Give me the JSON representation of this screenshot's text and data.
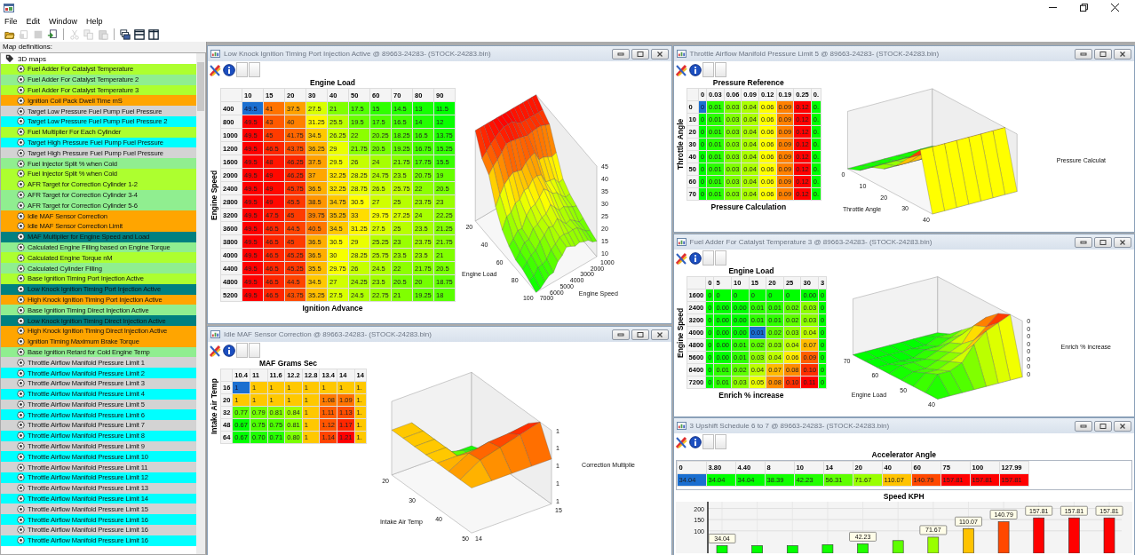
{
  "menu": [
    "File",
    "Edit",
    "Window",
    "Help"
  ],
  "toolbar": [
    [
      {
        "kind": "open",
        "disabled": false
      },
      {
        "kind": "properties",
        "disabled": true
      },
      {
        "kind": "save",
        "disabled": true
      },
      {
        "kind": "import",
        "disabled": false
      }
    ],
    [
      {
        "kind": "cut",
        "disabled": true
      },
      {
        "kind": "copy",
        "disabled": true
      },
      {
        "kind": "paste",
        "disabled": true
      }
    ],
    [
      {
        "kind": "cascade",
        "disabled": false
      },
      {
        "kind": "tile_horizontal",
        "disabled": false
      },
      {
        "kind": "tile_vertical",
        "disabled": false
      }
    ]
  ],
  "sidebar": {
    "label": "Map definitions:",
    "root": {
      "label": "3D maps",
      "children": [
        {
          "label": "Fuel Adder For Catalyst Temperature",
          "color": "#adff2f"
        },
        {
          "label": "Fuel Adder For Catalyst Temperature 2",
          "color": "#90ee90"
        },
        {
          "label": "Fuel Adder For Catalyst Temperature 3",
          "color": "#adff2f"
        },
        {
          "label": "Ignition Coil Pack Dwell Time mS",
          "color": "#ffa500"
        },
        {
          "label": "Target Low Pressure Fuel Pump Fuel Pressure",
          "color": "#d3d3d3"
        },
        {
          "label": "Target Low Pressure Fuel Pump Fuel Pressure 2",
          "color": "#00ffff"
        },
        {
          "label": "Fuel Multiplier For Each Cylinder",
          "color": "#adff2f"
        },
        {
          "label": "Target High Pressure Fuel Pump Fuel Pressure",
          "color": "#00ffff"
        },
        {
          "label": "Target High Pressure Fuel Pump Fuel Pressure",
          "color": "#d3d3d3"
        },
        {
          "label": "Fuel Injector Split % when Cold",
          "color": "#90ee90"
        },
        {
          "label": "Fuel Injector Split % when Cold",
          "color": "#adff2f"
        },
        {
          "label": "AFR Target for Correction Cylinder 1-2",
          "color": "#adff2f"
        },
        {
          "label": "AFR Target for Correction Cylinder 3-4",
          "color": "#90ee90"
        },
        {
          "label": "AFR Target for Correction Cylinder 5-6",
          "color": "#90ee90"
        },
        {
          "label": "Idle MAF Sensor Correction",
          "color": "#ffa500"
        },
        {
          "label": "Idle MAF Sensor Correction Limit",
          "color": "#ffa500"
        },
        {
          "label": "MAF Multiplier for Engine Speed and Load",
          "color": "#008080"
        },
        {
          "label": "Calculated Engine Filling based on Engine Torque",
          "color": "#90ee90"
        },
        {
          "label": "Calculated Engine Torque nM",
          "color": "#adff2f"
        },
        {
          "label": "Calculated Cylinder Filling",
          "color": "#90ee90"
        },
        {
          "label": "Base Ignition Timing Port Injection Active",
          "color": "#adff2f"
        },
        {
          "label": "Low Knock Ignition Timing Port Injection Active",
          "color": "#008080"
        },
        {
          "label": "High Knock Ignition Timing Port Injection Active",
          "color": "#ffa500"
        },
        {
          "label": "Base Ignition Timing Direct Injection Active",
          "color": "#90ee90"
        },
        {
          "label": "Low Knock Ignition Timing Direct Injection Active",
          "color": "#008080"
        },
        {
          "label": "High Knock Ignition Timing Direct Injection Active",
          "color": "#ffa500"
        },
        {
          "label": "Ignition Timing Maximum Brake Torque",
          "color": "#ffa500"
        },
        {
          "label": "Base Ignition Retard for Cold Engine Temp",
          "color": "#90ee90"
        },
        {
          "label": "Throttle Airflow Manifold Pressure Limit 1",
          "color": "#d3d3d3"
        },
        {
          "label": "Throttle Airflow Manifold Pressure Limit 2",
          "color": "#00ffff"
        },
        {
          "label": "Throttle Airflow Manifold Pressure Limit 3",
          "color": "#d3d3d3"
        },
        {
          "label": "Throttle Airflow Manifold Pressure Limit 4",
          "color": "#00ffff"
        },
        {
          "label": "Throttle Airflow Manifold Pressure Limit 5",
          "color": "#d3d3d3"
        },
        {
          "label": "Throttle Airflow Manifold Pressure Limit 6",
          "color": "#00ffff"
        },
        {
          "label": "Throttle Airflow Manifold Pressure Limit 7",
          "color": "#d3d3d3"
        },
        {
          "label": "Throttle Airflow Manifold Pressure Limit 8",
          "color": "#00ffff"
        },
        {
          "label": "Throttle Airflow Manifold Pressure Limit 9",
          "color": "#d3d3d3"
        },
        {
          "label": "Throttle Airflow Manifold Pressure Limit 10",
          "color": "#00ffff"
        },
        {
          "label": "Throttle Airflow Manifold Pressure Limit 11",
          "color": "#d3d3d3"
        },
        {
          "label": "Throttle Airflow Manifold Pressure Limit 12",
          "color": "#00ffff"
        },
        {
          "label": "Throttle Airflow Manifold Pressure Limit 13",
          "color": "#d3d3d3"
        },
        {
          "label": "Throttle Airflow Manifold Pressure Limit 14",
          "color": "#00ffff"
        },
        {
          "label": "Throttle Airflow Manifold Pressure Limit 15",
          "color": "#d3d3d3"
        },
        {
          "label": "Throttle Airflow Manifold Pressure Limit 16",
          "color": "#00ffff"
        },
        {
          "label": "Throttle Airflow Manifold Pressure Limit 16",
          "color": "#d3d3d3"
        },
        {
          "label": "Throttle Airflow Manifold Pressure Limit 16",
          "color": "#00ffff"
        }
      ]
    }
  },
  "windows": [
    {
      "kind": "map",
      "title": "Low Knock Ignition Timing Port Injection Active @ 89663-24283- (STOCK-24283.bin)",
      "table": {
        "column_axis": "Engine Load",
        "row_axis": "Engine Speed",
        "value_axis": "Ignition Advance",
        "columns": [
          "10",
          "15",
          "20",
          "30",
          "40",
          "50",
          "60",
          "70",
          "80",
          "90"
        ],
        "rows": [
          {
            "label": "400",
            "cells": [
              "49.5",
              "41",
              "37.5",
              "27.5",
              "21",
              "17.5",
              "15",
              "14.5",
              "13",
              "11.5"
            ],
            "selected": [
              true,
              false,
              false,
              false,
              false,
              false,
              false,
              false,
              false,
              false
            ]
          },
          {
            "label": "800",
            "cells": [
              "49.5",
              "43",
              "40",
              "31.25",
              "25.5",
              "19.5",
              "17.5",
              "16.5",
              "14",
              "12"
            ],
            "selected": [
              false,
              false,
              false,
              false,
              false,
              false,
              false,
              false,
              false,
              false
            ]
          },
          {
            "label": "1000",
            "cells": [
              "49.5",
              "45",
              "41.75",
              "34.5",
              "26.25",
              "22",
              "20.25",
              "18.25",
              "16.5",
              "13.75"
            ],
            "selected": [
              false,
              false,
              false,
              false,
              false,
              false,
              false,
              false,
              false,
              false
            ]
          },
          {
            "label": "1200",
            "cells": [
              "49.5",
              "46.5",
              "43.75",
              "36.25",
              "29",
              "21.75",
              "20.5",
              "19.25",
              "16.75",
              "15.25"
            ],
            "selected": [
              false,
              false,
              false,
              false,
              false,
              false,
              false,
              false,
              false,
              false
            ]
          },
          {
            "label": "1600",
            "cells": [
              "49.5",
              "48",
              "46.25",
              "37.5",
              "29.5",
              "26",
              "24",
              "21.75",
              "17.75",
              "15.5"
            ],
            "selected": [
              false,
              false,
              false,
              false,
              false,
              false,
              false,
              false,
              false,
              false
            ]
          },
          {
            "label": "2000",
            "cells": [
              "49.5",
              "49",
              "46.25",
              "37",
              "32.25",
              "28.25",
              "24.75",
              "23.5",
              "20.75",
              "19"
            ],
            "selected": [
              false,
              false,
              false,
              false,
              false,
              false,
              false,
              false,
              false,
              false
            ]
          },
          {
            "label": "2400",
            "cells": [
              "49.5",
              "49",
              "45.75",
              "36.5",
              "32.25",
              "28.75",
              "26.5",
              "25.75",
              "22",
              "20.5"
            ],
            "selected": [
              false,
              false,
              false,
              false,
              false,
              false,
              false,
              false,
              false,
              false
            ]
          },
          {
            "label": "2800",
            "cells": [
              "49.5",
              "49",
              "45.5",
              "38.5",
              "34.75",
              "30.5",
              "27",
              "25",
              "23.75",
              "23"
            ],
            "selected": [
              false,
              false,
              false,
              false,
              false,
              false,
              false,
              false,
              false,
              false
            ]
          },
          {
            "label": "3200",
            "cells": [
              "49.5",
              "47.5",
              "45",
              "39.75",
              "35.25",
              "33",
              "29.75",
              "27.25",
              "24",
              "22.25"
            ],
            "selected": [
              false,
              false,
              false,
              false,
              false,
              false,
              false,
              false,
              false,
              false
            ]
          },
          {
            "label": "3600",
            "cells": [
              "49.5",
              "46.5",
              "44.5",
              "40.5",
              "34.5",
              "31.25",
              "27.5",
              "25",
              "23.5",
              "21.25"
            ],
            "selected": [
              false,
              false,
              false,
              false,
              false,
              false,
              false,
              false,
              false,
              false
            ]
          },
          {
            "label": "3800",
            "cells": [
              "49.5",
              "46.5",
              "45",
              "36.5",
              "30.5",
              "29",
              "25.25",
              "23",
              "23.75",
              "21.75"
            ],
            "selected": [
              false,
              false,
              false,
              false,
              false,
              false,
              false,
              false,
              false,
              false
            ]
          },
          {
            "label": "4000",
            "cells": [
              "49.5",
              "46.5",
              "45.25",
              "36.5",
              "30",
              "28.25",
              "25.75",
              "23.5",
              "23.5",
              "21"
            ],
            "selected": [
              false,
              false,
              false,
              false,
              false,
              false,
              false,
              false,
              false,
              false
            ]
          },
          {
            "label": "4400",
            "cells": [
              "49.5",
              "46.5",
              "45.25",
              "35.5",
              "29.75",
              "26",
              "24.5",
              "22",
              "21.75",
              "20.5"
            ],
            "selected": [
              false,
              false,
              false,
              false,
              false,
              false,
              false,
              false,
              false,
              false
            ]
          },
          {
            "label": "4800",
            "cells": [
              "49.5",
              "46.5",
              "44.5",
              "34.5",
              "27",
              "24.25",
              "23.5",
              "20.5",
              "20",
              "18.75"
            ],
            "selected": [
              false,
              false,
              false,
              false,
              false,
              false,
              false,
              false,
              false,
              false
            ]
          },
          {
            "label": "5200",
            "cells": [
              "49.5",
              "46.5",
              "43.75",
              "35.25",
              "27.5",
              "24.5",
              "22.75",
              "21",
              "19.25",
              "18"
            ],
            "selected": [
              false,
              false,
              false,
              false,
              false,
              false,
              false,
              false,
              false,
              false
            ]
          }
        ]
      },
      "plot": {
        "x_title": "Engine Load",
        "x_ticks": [
          "20",
          "40",
          "60",
          "80",
          "100"
        ],
        "y_title": "Engine Speed",
        "y_ticks": [
          "7000",
          "6000",
          "5000",
          "4000",
          "3000",
          "2000",
          "1000"
        ],
        "z_ticks": [
          "45",
          "40",
          "35",
          "30",
          "25",
          "20",
          "15",
          "10"
        ]
      }
    },
    {
      "kind": "map",
      "title": "Throttle Airflow Manifold Pressure Limit 5 @ 89663-24283- (STOCK-24283.bin)",
      "table": {
        "column_axis": "Pressure Reference",
        "row_axis": "Throttle Angle",
        "value_axis": "Pressure Calculation",
        "columns": [
          "0",
          "0.03",
          "0.06",
          "0.09",
          "0.12",
          "0.19",
          "0.25",
          "0."
        ],
        "rows": [
          {
            "label": "0",
            "cells": [
              "0",
              "0.01",
              "0.03",
              "0.04",
              "0.06",
              "0.09",
              "0.12",
              "0."
            ],
            "selected": [
              true,
              false,
              false,
              false,
              false,
              false,
              false,
              false
            ]
          },
          {
            "label": "10",
            "cells": [
              "0",
              "0.01",
              "0.03",
              "0.04",
              "0.06",
              "0.09",
              "0.12",
              "0."
            ],
            "selected": [
              false,
              false,
              false,
              false,
              false,
              false,
              false,
              false
            ]
          },
          {
            "label": "20",
            "cells": [
              "0",
              "0.01",
              "0.03",
              "0.04",
              "0.06",
              "0.09",
              "0.12",
              "0."
            ],
            "selected": [
              false,
              false,
              false,
              false,
              false,
              false,
              false,
              false
            ]
          },
          {
            "label": "30",
            "cells": [
              "0",
              "0.01",
              "0.03",
              "0.04",
              "0.06",
              "0.09",
              "0.12",
              "0."
            ],
            "selected": [
              false,
              false,
              false,
              false,
              false,
              false,
              false,
              false
            ]
          },
          {
            "label": "40",
            "cells": [
              "0",
              "0.01",
              "0.03",
              "0.04",
              "0.06",
              "0.09",
              "0.12",
              "0."
            ],
            "selected": [
              false,
              false,
              false,
              false,
              false,
              false,
              false,
              false
            ]
          },
          {
            "label": "50",
            "cells": [
              "0",
              "0.01",
              "0.03",
              "0.04",
              "0.06",
              "0.09",
              "0.12",
              "0."
            ],
            "selected": [
              false,
              false,
              false,
              false,
              false,
              false,
              false,
              false
            ]
          },
          {
            "label": "60",
            "cells": [
              "0",
              "0.01",
              "0.03",
              "0.04",
              "0.06",
              "0.09",
              "0.12",
              "0."
            ],
            "selected": [
              false,
              false,
              false,
              false,
              false,
              false,
              false,
              false
            ]
          },
          {
            "label": "70",
            "cells": [
              "0",
              "0.01",
              "0.03",
              "0.04",
              "0.06",
              "0.09",
              "0.12",
              "0."
            ],
            "selected": [
              false,
              false,
              false,
              false,
              false,
              false,
              false,
              false
            ]
          }
        ]
      },
      "plot": {
        "x_title": "Throttle Angle",
        "x_ticks": [
          "0",
          "10",
          "20",
          "30",
          "40"
        ],
        "z_title": "Pressure Calculat"
      }
    },
    {
      "kind": "map",
      "title": "Fuel Adder For Catalyst Temperature 3 @ 89663-24283- (STOCK-24283.bin)",
      "table": {
        "column_axis": "Engine Load",
        "row_axis": "Engine Speed",
        "value_axis": "Enrich % increase",
        "columns": [
          "0",
          "5",
          "10",
          "15",
          "20",
          "25",
          "30",
          "3"
        ],
        "rows": [
          {
            "label": "1600",
            "cells": [
              "0",
              "0",
              "0",
              "0",
              "0",
              "0",
              "0.00",
              "0"
            ],
            "selected": [
              false,
              false,
              false,
              false,
              false,
              false,
              false,
              false
            ]
          },
          {
            "label": "2400",
            "cells": [
              "0",
              "0.00",
              "0.00",
              "0.01",
              "0.01",
              "0.02",
              "0.03",
              "0"
            ],
            "selected": [
              false,
              false,
              false,
              false,
              false,
              false,
              false,
              false
            ]
          },
          {
            "label": "3200",
            "cells": [
              "0",
              "0.00",
              "0.00",
              "0.01",
              "0.01",
              "0.02",
              "0.03",
              "0"
            ],
            "selected": [
              false,
              false,
              false,
              false,
              false,
              false,
              false,
              false
            ]
          },
          {
            "label": "4000",
            "cells": [
              "0",
              "0.00",
              "0.00",
              "0.01",
              "0.02",
              "0.03",
              "0.04",
              "0"
            ],
            "selected": [
              false,
              false,
              false,
              true,
              false,
              false,
              false,
              false
            ]
          },
          {
            "label": "4800",
            "cells": [
              "0",
              "0.00",
              "0.01",
              "0.02",
              "0.03",
              "0.04",
              "0.07",
              "0"
            ],
            "selected": [
              false,
              false,
              false,
              false,
              false,
              false,
              false,
              false
            ]
          },
          {
            "label": "5600",
            "cells": [
              "0",
              "0.00",
              "0.01",
              "0.03",
              "0.04",
              "0.06",
              "0.09",
              "0"
            ],
            "selected": [
              false,
              false,
              false,
              false,
              false,
              false,
              false,
              false
            ]
          },
          {
            "label": "6400",
            "cells": [
              "0",
              "0.01",
              "0.02",
              "0.04",
              "0.07",
              "0.08",
              "0.10",
              "0"
            ],
            "selected": [
              false,
              false,
              false,
              false,
              false,
              false,
              false,
              false
            ]
          },
          {
            "label": "7200",
            "cells": [
              "0",
              "0.01",
              "0.03",
              "0.05",
              "0.08",
              "0.10",
              "0.11",
              "0"
            ],
            "selected": [
              false,
              false,
              false,
              false,
              false,
              false,
              false,
              false
            ]
          }
        ]
      },
      "plot": {
        "x_title": "Engine Load",
        "x_ticks": [
          "70",
          "60",
          "50",
          "40"
        ],
        "z_title": "Enrich % increase",
        "z_ticks": [
          "0",
          "0",
          "0",
          "0",
          "0",
          "0",
          "0",
          "0"
        ]
      }
    },
    {
      "kind": "map",
      "title": "Idle MAF Sensor Correction @ 89663-24283- (STOCK-24283.bin)",
      "table": {
        "column_axis": "MAF Grams Sec",
        "row_axis": "Intake Air Temp",
        "columns": [
          "10.4",
          "11",
          "11.6",
          "12.2",
          "12.8",
          "13.4",
          "14",
          "14"
        ],
        "rows": [
          {
            "label": "16",
            "cells": [
              "1",
              "1",
              "1",
              "1",
              "1",
              "1",
              "1",
              "1."
            ],
            "selected": [
              true,
              false,
              false,
              false,
              false,
              false,
              false,
              false
            ]
          },
          {
            "label": "20",
            "cells": [
              "1",
              "1",
              "1",
              "1",
              "1",
              "1.08",
              "1.09",
              "1."
            ],
            "selected": [
              false,
              false,
              false,
              false,
              false,
              false,
              false,
              false
            ]
          },
          {
            "label": "32",
            "cells": [
              "0.77",
              "0.79",
              "0.81",
              "0.84",
              "1",
              "1.11",
              "1.13",
              "1."
            ],
            "selected": [
              false,
              false,
              false,
              false,
              false,
              false,
              false,
              false
            ]
          },
          {
            "label": "48",
            "cells": [
              "0.67",
              "0.75",
              "0.75",
              "0.81",
              "1",
              "1.12",
              "1.17",
              "1."
            ],
            "selected": [
              false,
              false,
              false,
              false,
              false,
              false,
              false,
              false
            ]
          },
          {
            "label": "64",
            "cells": [
              "0.67",
              "0.70",
              "0.71",
              "0.80",
              "1",
              "1.14",
              "1.21",
              "1."
            ],
            "selected": [
              false,
              false,
              false,
              false,
              false,
              false,
              false,
              false
            ]
          }
        ]
      },
      "plot": {
        "x_title": "Intake Air Temp",
        "x_ticks": [
          "20",
          "30",
          "40",
          "50"
        ],
        "y_ticks": [
          "14",
          "15"
        ],
        "z_title": "Correction Multiplie",
        "z_ticks": [
          "1",
          "1",
          "1",
          "1",
          "1"
        ]
      }
    },
    {
      "kind": "schedule",
      "title": "3 Upshift Schedule 6 to 7 @ 89663-24283- (STOCK-24283.bin)",
      "table": {
        "column_axis": "Accelerator Angle",
        "columns": [
          "0",
          "3.80",
          "4.40",
          "8",
          "10",
          "14",
          "20",
          "40",
          "60",
          "75",
          "100",
          "127.99"
        ],
        "cells": [
          "34.04",
          "34.04",
          "34.04",
          "38.39",
          "42.23",
          "56.31",
          "71.67",
          "110.07",
          "140.79",
          "157.81",
          "157.81",
          "157.81"
        ],
        "selected": [
          true,
          false,
          false,
          false,
          false,
          false,
          false,
          false,
          false,
          false,
          false,
          false
        ]
      },
      "chart_data": {
        "type": "bar",
        "title": "Speed KPH",
        "ylim": [
          0,
          230
        ],
        "grid": true,
        "values": [
          34.04,
          34.04,
          34.04,
          38.39,
          42.23,
          56.31,
          71.67,
          110.07,
          140.79,
          157.81,
          157.81,
          157.81
        ],
        "yticks": [
          100,
          150,
          200
        ],
        "value_labels": [
          "34.04",
          null,
          null,
          null,
          "42.23",
          null,
          "71.67",
          "110.07",
          "140.79",
          "157.81",
          "157.81",
          "157.81"
        ]
      }
    }
  ]
}
